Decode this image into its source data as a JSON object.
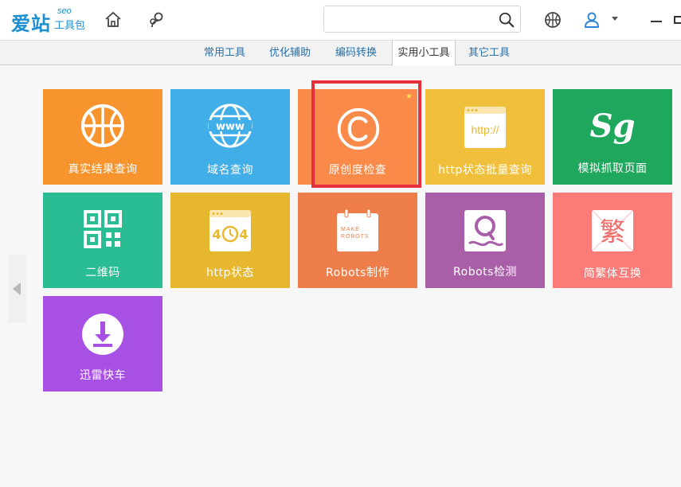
{
  "app": {
    "logo_main": "爱站",
    "logo_seo": "seo",
    "logo_sub": "工具包"
  },
  "search": {
    "value": "",
    "placeholder": ""
  },
  "tabs": [
    {
      "label": "常用工具",
      "active": false
    },
    {
      "label": "优化辅助",
      "active": false
    },
    {
      "label": "编码转换",
      "active": false
    },
    {
      "label": "实用小工具",
      "active": true
    },
    {
      "label": "其它工具",
      "active": false
    }
  ],
  "tiles": [
    {
      "label": "真实结果查询",
      "color": "#f7942e",
      "icon": "basketball-icon"
    },
    {
      "label": "域名查询",
      "color": "#42aee8",
      "icon": "www-globe-icon"
    },
    {
      "label": "原创度检查",
      "color": "#f98a4a",
      "icon": "copyright-icon"
    },
    {
      "label": "http状态批量查询",
      "color": "#f0bf3c",
      "icon": "browser-http-icon",
      "icon_text": "http://"
    },
    {
      "label": "模拟抓取页面",
      "color": "#1fa85d",
      "icon": "sg-logo-icon",
      "icon_text": "Sg"
    },
    {
      "label": "二维码",
      "color": "#2abc93",
      "icon": "qr-code-icon"
    },
    {
      "label": "http状态",
      "color": "#e8b730",
      "icon": "404-clock-icon"
    },
    {
      "label": "Robots制作",
      "color": "#ee7e49",
      "icon": "make-robots-icon",
      "icon_text": "MAKE ROBOTS"
    },
    {
      "label": "Robots检测",
      "color": "#a95fa7",
      "icon": "robots-check-icon"
    },
    {
      "label": "简繁体互换",
      "color": "#fb7b79",
      "icon": "traditional-char-icon",
      "icon_text": "繁"
    },
    {
      "label": "迅雷快车",
      "color": "#a750e3",
      "icon": "download-icon"
    }
  ]
}
